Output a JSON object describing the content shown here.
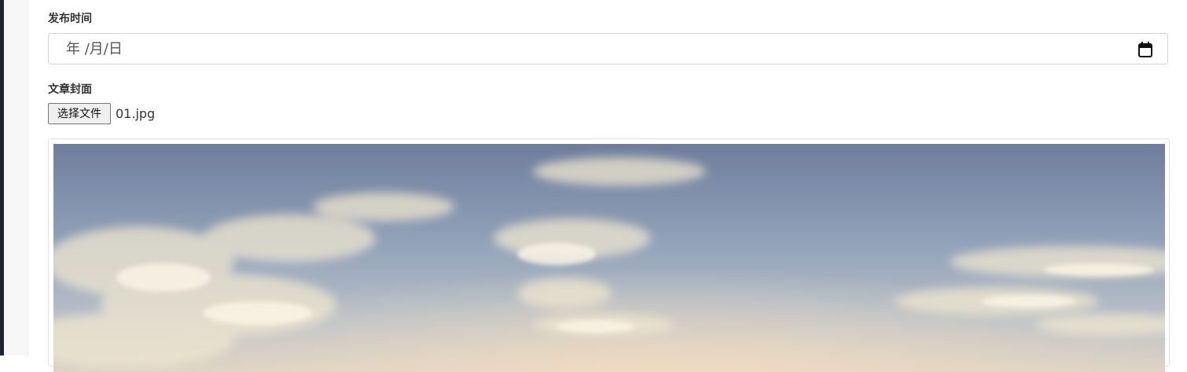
{
  "form": {
    "publish_time_label": "发布时间",
    "publish_time_display": "年 /月/日",
    "cover_label": "文章封面",
    "choose_file_label": "选择文件",
    "chosen_file_name": "01.jpg"
  },
  "icons": {
    "calendar": "calendar-icon"
  },
  "colors": {
    "sidebar": "#1f2433",
    "input_border": "#ced4da",
    "sky_top": "#6f7d9c",
    "sky_bottom": "#d9d2c5"
  }
}
